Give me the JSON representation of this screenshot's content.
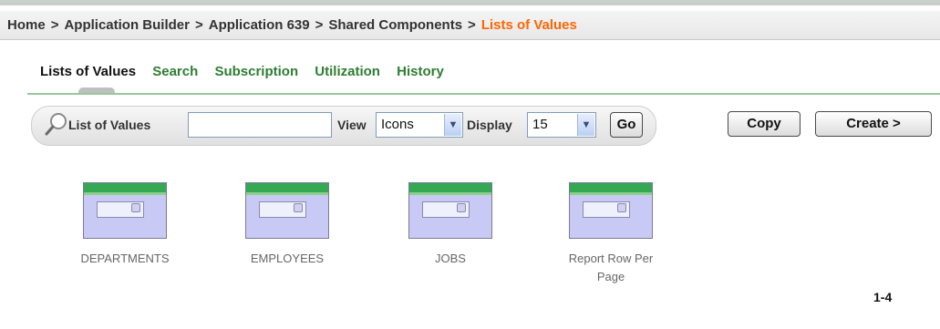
{
  "breadcrumb": {
    "items": [
      "Home",
      "Application Builder",
      "Application 639",
      "Shared Components"
    ],
    "separator": ">",
    "current": "Lists of Values",
    "current_color": "#ff6600"
  },
  "tabs": [
    {
      "label": "Lists of Values",
      "active": true
    },
    {
      "label": "Search",
      "active": false
    },
    {
      "label": "Subscription",
      "active": false
    },
    {
      "label": "Utilization",
      "active": false
    },
    {
      "label": "History",
      "active": false
    }
  ],
  "toolbar": {
    "search_icon": "magnifier-icon",
    "search_label": "List of Values",
    "search_value": "",
    "view_label": "View",
    "view_value": "Icons",
    "display_label": "Display",
    "display_value": "15",
    "go_label": "Go"
  },
  "actions": {
    "copy_label": "Copy",
    "create_label": "Create >"
  },
  "items": [
    {
      "name": "DEPARTMENTS",
      "icon": "list-of-values-icon"
    },
    {
      "name": "EMPLOYEES",
      "icon": "list-of-values-icon"
    },
    {
      "name": "JOBS",
      "icon": "list-of-values-icon"
    },
    {
      "name": "Report Row Per Page",
      "icon": "list-of-values-icon"
    }
  ],
  "pagination": {
    "range": "1-4"
  },
  "colors": {
    "tab_green": "#2e7d32",
    "accent_orange": "#ff6600",
    "icon_header_green": "#34a853",
    "icon_body": "#c9c9f5"
  }
}
